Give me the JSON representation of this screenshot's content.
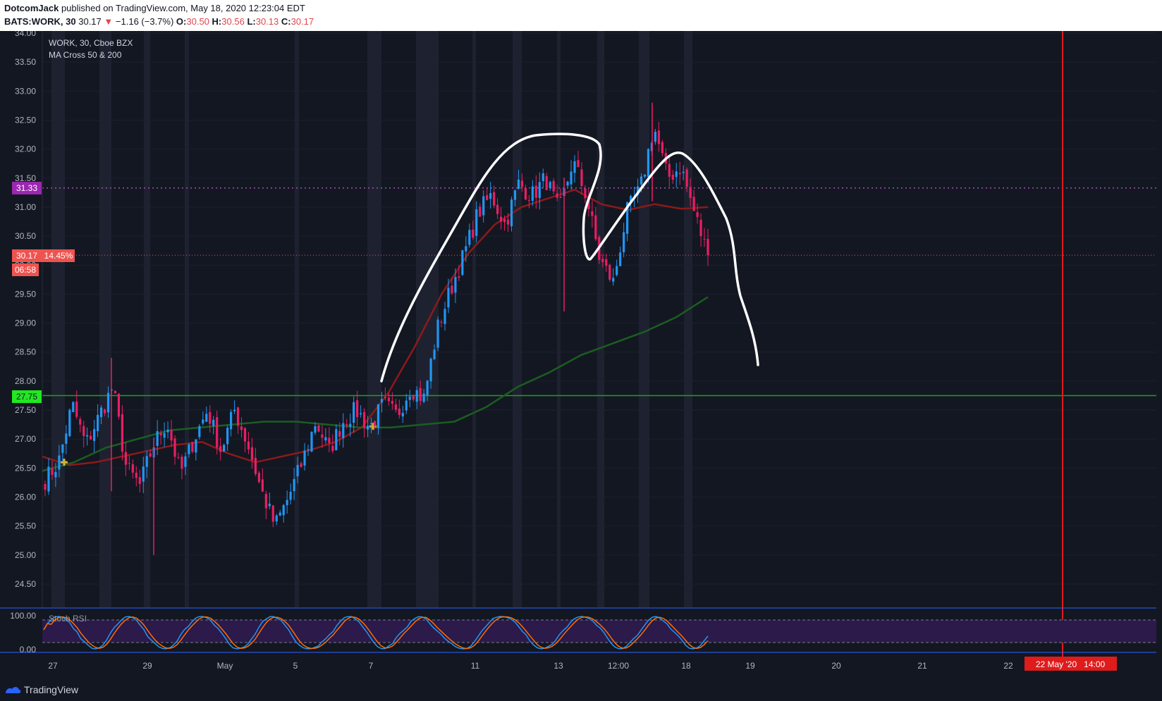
{
  "header": {
    "author": "DotcomJack",
    "published": "published on TradingView.com, May 18, 2020 12:23:04 EDT",
    "symbol": "BATS:WORK, 30",
    "last": "30.17",
    "change": "−1.16 (−3.7%)",
    "o_label": "O:",
    "o": "30.50",
    "h_label": "H:",
    "h": "30.56",
    "l_label": "L:",
    "l": "30.13",
    "c_label": "C:",
    "c": "30.17"
  },
  "legend": {
    "line1": "WORK, 30, Cboe BZX",
    "line2": "MA Cross 50 & 200"
  },
  "stoch": {
    "label": "Stoch RSI",
    "ticks": [
      "100.00",
      "0.00"
    ]
  },
  "price_tags": {
    "purple": "31.33",
    "current": "30.17",
    "current_pct": "14.45%",
    "countdown": "06:58",
    "green": "27.75"
  },
  "time_tag": "22 May '20   14:00",
  "footer": {
    "brand": "TradingView"
  },
  "colors": {
    "background": "#131722",
    "up": "#2196f3",
    "down": "#e91e63",
    "ma50": "#8b1a1a",
    "ma200": "#1b5e20",
    "purple_line": "#ab47bc",
    "green_line": "#1aa31a",
    "red_vline": "#e01b1b"
  },
  "chart_data": {
    "type": "candlestick",
    "title": "WORK, 30, Cboe BZX",
    "indicator": "MA Cross 50 & 200",
    "ylim": [
      24.3,
      34.0
    ],
    "y_ticks": [
      34.0,
      33.5,
      33.0,
      32.5,
      32.0,
      31.5,
      31.0,
      30.5,
      30.0,
      29.5,
      29.0,
      28.5,
      28.0,
      27.5,
      27.0,
      26.5,
      26.0,
      25.5,
      25.0,
      24.5
    ],
    "x_ticks": [
      "27",
      "29",
      "May",
      "5",
      "7",
      "11",
      "13",
      "12:00",
      "18",
      "19",
      "20",
      "21",
      "22"
    ],
    "horizontal_lines": [
      31.33,
      30.17,
      27.75
    ],
    "close_path": [
      [
        "Apr 27",
        26.3
      ],
      [
        "Apr 27",
        26.6
      ],
      [
        "Apr 28",
        27.6
      ],
      [
        "Apr 28",
        26.9
      ],
      [
        "Apr 28",
        27.4
      ],
      [
        "Apr 28",
        27.9
      ],
      [
        "Apr 28",
        26.5
      ],
      [
        "Apr 29",
        26.2
      ],
      [
        "Apr 29",
        26.9
      ],
      [
        "Apr 29",
        27.3
      ],
      [
        "Apr 29",
        26.4
      ],
      [
        "Apr 30",
        27.0
      ],
      [
        "Apr 30",
        27.5
      ],
      [
        "Apr 30",
        26.8
      ],
      [
        "Apr 30",
        27.5
      ],
      [
        "Apr 30",
        26.9
      ],
      [
        "May 1",
        26.1
      ],
      [
        "May 1",
        25.5
      ],
      [
        "May 1",
        26.0
      ],
      [
        "May 4",
        26.6
      ],
      [
        "May 4",
        27.3
      ],
      [
        "May 4",
        26.8
      ],
      [
        "May 5",
        27.3
      ],
      [
        "May 5",
        27.5
      ],
      [
        "May 5",
        27.2
      ],
      [
        "May 6",
        27.6
      ],
      [
        "May 6",
        27.4
      ],
      [
        "May 6",
        27.9
      ],
      [
        "May 7",
        27.7
      ],
      [
        "May 7",
        28.9
      ],
      [
        "May 7",
        29.6
      ],
      [
        "May 8",
        30.2
      ],
      [
        "May 8",
        30.9
      ],
      [
        "May 11",
        31.2
      ],
      [
        "May 11",
        30.7
      ],
      [
        "May 11",
        31.4
      ],
      [
        "May 12",
        31.2
      ],
      [
        "May 12",
        31.5
      ],
      [
        "May 12",
        30.9
      ],
      [
        "May 12",
        31.8
      ],
      [
        "May 13",
        31.2
      ],
      [
        "May 13",
        30.1
      ],
      [
        "May 13",
        29.7
      ],
      [
        "May 14",
        30.9
      ],
      [
        "May 14",
        31.3
      ],
      [
        "May 14",
        32.4
      ],
      [
        "May 15",
        31.5
      ],
      [
        "May 15",
        31.7
      ],
      [
        "May 18",
        30.9
      ],
      [
        "May 18",
        30.17
      ]
    ],
    "series": [
      {
        "name": "MA 50",
        "values": [
          26.7,
          26.55,
          26.6,
          26.7,
          26.8,
          26.9,
          26.95,
          26.75,
          26.6,
          26.7,
          26.8,
          26.95,
          27.2,
          27.8,
          28.6,
          29.5,
          30.2,
          30.7,
          31.0,
          31.15,
          31.3,
          31.05,
          30.95,
          31.05,
          30.97,
          31.0
        ]
      },
      {
        "name": "MA 200",
        "values": [
          26.45,
          26.6,
          26.85,
          27.0,
          27.15,
          27.2,
          27.25,
          27.3,
          27.3,
          27.25,
          27.2,
          27.2,
          27.25,
          27.3,
          27.55,
          27.9,
          28.15,
          28.45,
          28.65,
          28.85,
          29.1,
          29.45
        ]
      }
    ],
    "annotations": [
      "hand-drawn double-top outline",
      "golden cross markers"
    ]
  }
}
